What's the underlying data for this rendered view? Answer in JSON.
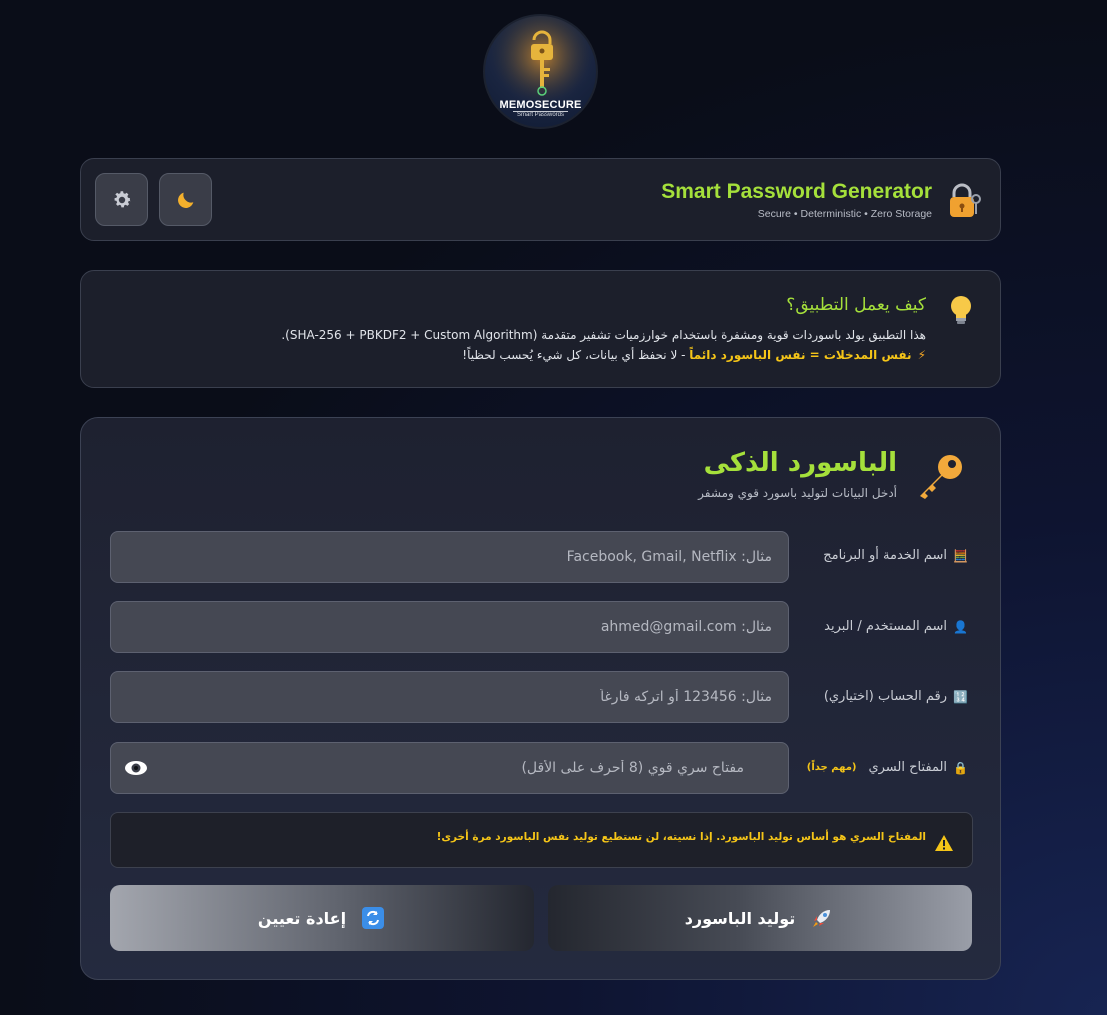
{
  "logo": {
    "title": "MEMOSECURE",
    "subtitle": "Smart Passwords"
  },
  "header": {
    "title": "Smart Password Generator",
    "subtitle": "Secure • Deterministic • Zero Storage",
    "settings_icon": "gear-icon",
    "theme_icon": "moon-icon",
    "lock_icon": "lock-key-icon"
  },
  "info": {
    "title": "كيف يعمل التطبيق؟",
    "line1": "هذا التطبيق يولد باسوردات قوية ومشفرة باستخدام خوارزميات تشفير متقدمة (SHA-256 + PBKDF2 + Custom Algorithm).",
    "line2_highlight": "نفس المدخلات = نفس الباسورد دائماً",
    "line2_rest": " - لا نحفظ أي بيانات، كل شيء يُحسب لحظياً!"
  },
  "main": {
    "title": "الباسورد الذكى",
    "subtitle": "أدخل البيانات لتوليد باسورد قوي ومشفر",
    "fields": [
      {
        "label": "اسم الخدمة أو البرنامج",
        "icon": "abacus-icon",
        "placeholder": "مثال: Facebook, Gmail, Netflix",
        "value": ""
      },
      {
        "label": "اسم المستخدم / البريد",
        "icon": "user-icon",
        "placeholder": "مثال: ahmed@gmail.com",
        "value": ""
      },
      {
        "label": "رقم الحساب (اختياري)",
        "icon": "numbers-icon",
        "placeholder": "مثال: 123456 أو اتركه فارغاً",
        "value": ""
      },
      {
        "label": "المفتاح السري",
        "icon": "lock-icon",
        "required": "(مهم جداً)",
        "placeholder": "مفتاح سري قوي (8 أحرف على الأقل)",
        "value": ""
      }
    ],
    "warning": "المفتاح السري هو أساس توليد الباسورد. إذا نسيته، لن تستطيع توليد نفس الباسورد مرة أخرى!",
    "generate_label": "توليد الباسورد",
    "reset_label": "إعادة تعيين"
  },
  "colors": {
    "accent": "#a5e03b",
    "warning": "#f5c518",
    "background": "#0a0d18"
  }
}
